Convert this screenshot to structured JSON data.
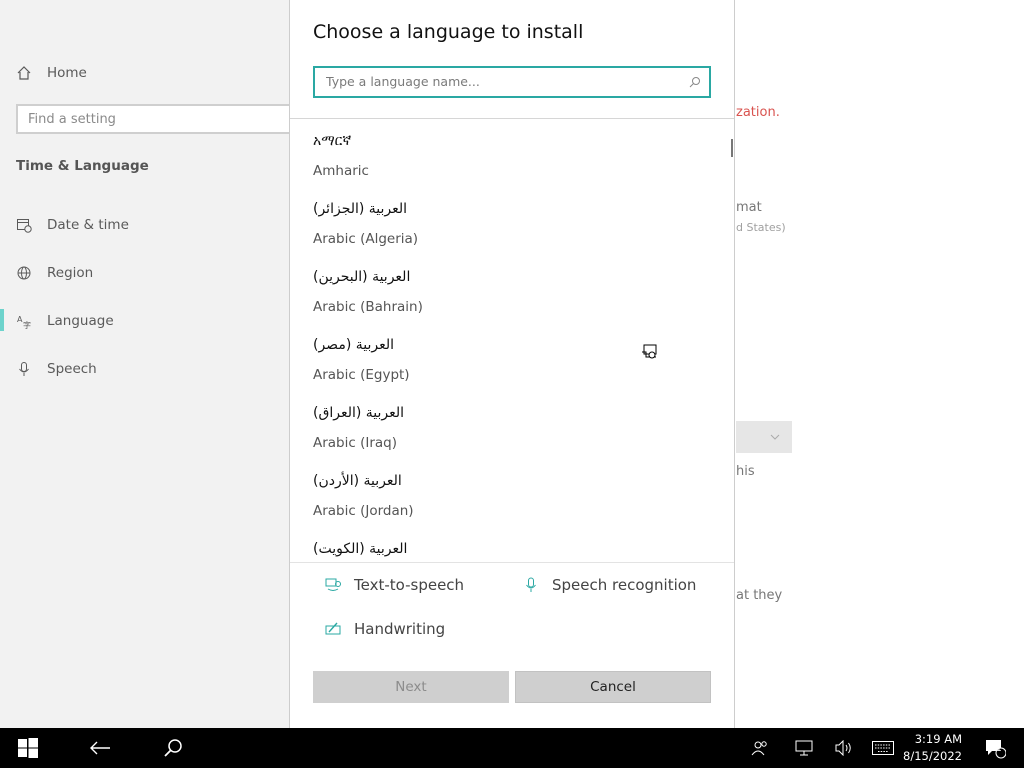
{
  "settings_nav": {
    "home_label": "Home",
    "search_placeholder": "Find a setting",
    "section_title": "Time & Language",
    "items": [
      {
        "label": "Date & time",
        "icon": "calendar-clock-icon"
      },
      {
        "label": "Region",
        "icon": "globe-icon"
      },
      {
        "label": "Language",
        "icon": "language-icon",
        "selected": true
      },
      {
        "label": "Speech",
        "icon": "microphone-icon"
      }
    ]
  },
  "background_partial_text": {
    "line1": "zation.",
    "line2": "mat",
    "line3": "d States)",
    "line4": "his",
    "line5": "at they"
  },
  "dialog": {
    "title": "Choose a language to install",
    "search_placeholder": "Type a language name...",
    "languages": [
      {
        "native": "አማርኛ",
        "english": "Amharic"
      },
      {
        "native": "العربية (الجزائر)",
        "english": "Arabic (Algeria)"
      },
      {
        "native": "العربية (البحرين)",
        "english": "Arabic (Bahrain)"
      },
      {
        "native": "العربية (مصر)",
        "english": "Arabic (Egypt)"
      },
      {
        "native": "العربية (العراق)",
        "english": "Arabic (Iraq)"
      },
      {
        "native": "العربية (الأردن)",
        "english": "Arabic (Jordan)"
      },
      {
        "native": "العربية (الكويت)",
        "english": ""
      }
    ],
    "features": {
      "tts": "Text-to-speech",
      "speech_recognition": "Speech recognition",
      "handwriting": "Handwriting"
    },
    "next_label": "Next",
    "cancel_label": "Cancel"
  },
  "taskbar": {
    "time": "3:19 AM",
    "date": "8/15/2022",
    "notification_count": "1"
  },
  "colors": {
    "accent": "#2aa8a3",
    "nav_background": "#f2f2f2",
    "taskbar": "#000000",
    "error_text": "#d9534f"
  }
}
